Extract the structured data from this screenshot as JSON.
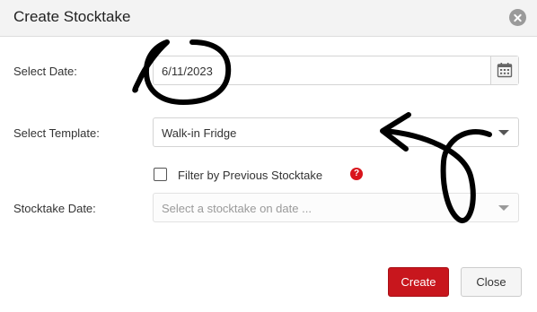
{
  "dialog": {
    "title": "Create Stocktake",
    "close_icon": "close-circle-icon"
  },
  "form": {
    "date": {
      "label": "Select Date:",
      "value": "6/11/2023",
      "icon": "calendar-icon"
    },
    "template": {
      "label": "Select Template:",
      "value": "Walk-in Fridge"
    },
    "filter": {
      "label": "Filter by Previous Stocktake",
      "checked": false,
      "help_icon": "help-icon",
      "help_text": "?"
    },
    "stocktake_date": {
      "label": "Stocktake Date:",
      "placeholder": "Select a stocktake on date ..."
    }
  },
  "footer": {
    "create_label": "Create",
    "close_label": "Close"
  },
  "colors": {
    "primary": "#c8161d",
    "header_bg": "#f3f3f3",
    "annotation": "#000000"
  }
}
